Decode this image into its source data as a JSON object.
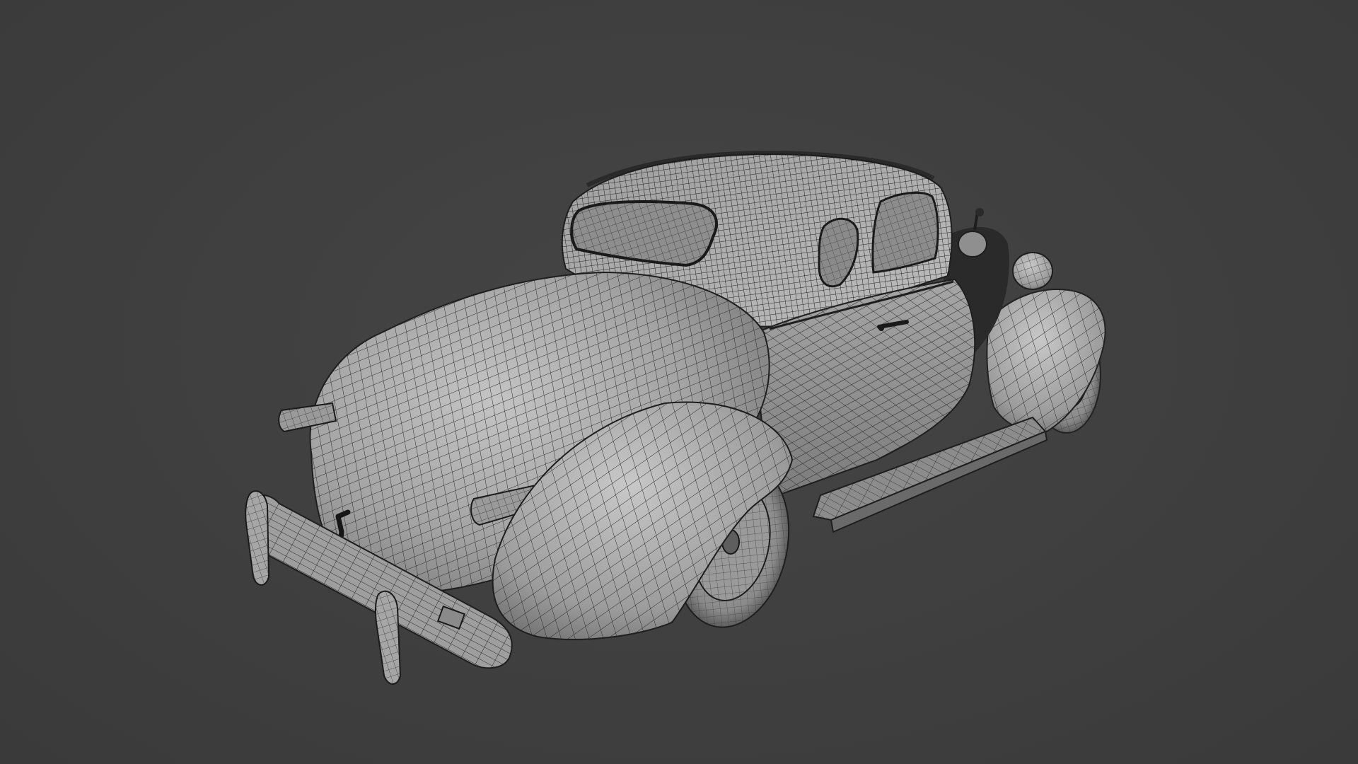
{
  "viewport": {
    "background_color": "#404040",
    "mesh_fill_color": "#a8a8a8",
    "mesh_wire_color": "#2a2a2a",
    "mesh_dark_detail_color": "#1c1c1c",
    "shading_mode": "wireframe-overlay",
    "subject": "vintage-coupe-mesh"
  }
}
